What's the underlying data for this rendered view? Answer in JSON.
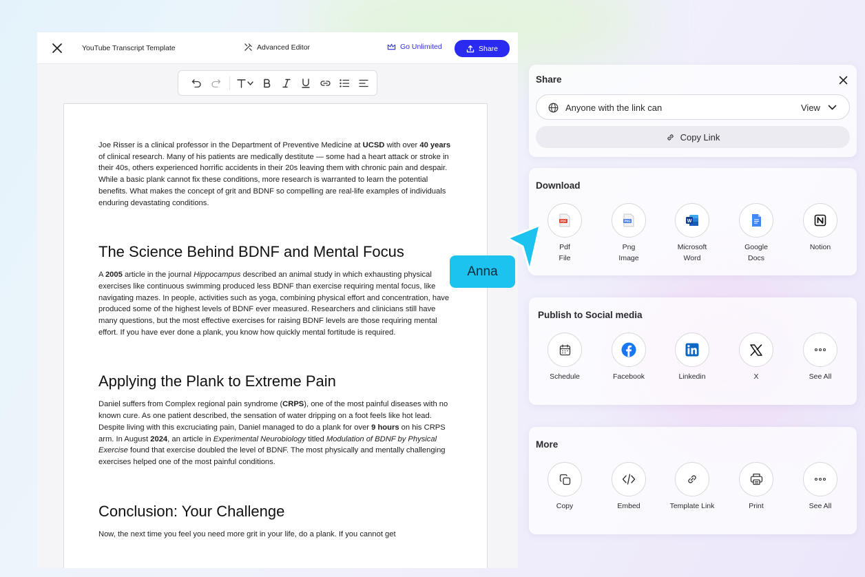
{
  "editor": {
    "doc_title": "YouTube Transcript Template",
    "advanced_editor": "Advanced Editor",
    "go_unlimited": "Go Unlimited",
    "share_button": "Share"
  },
  "document": {
    "intro": {
      "t1": "Joe Risser is a clinical professor in the Department of Preventive Medicine at ",
      "b1": "UCSD",
      "t2": " with over ",
      "b2": "40 years",
      "t3": " of clinical research. Many of his patients are medically destitute — some had a heart attack or stroke in their 40s, others experienced horrific accidents in their 20s leaving them with chronic pain and despair. While a basic plank cannot fix these conditions, more research is warranted to learn the potential benefits. What makes the concept of grit and BDNF so compelling are real-life examples of individuals enduring devastating conditions."
    },
    "h1": "The Science Behind BDNF and Mental Focus",
    "p2": {
      "t1": "A ",
      "b1": "2005",
      "t2": " article in the journal ",
      "i1": "Hippocampus",
      "t3": " described an animal study in which exhausting physical exercises like continuous swimming produced less BDNF than exercise requiring mental focus, like navigating mazes. In people, activities such as yoga, combining physical effort and concentration, have produced some of the highest levels of BDNF ever measured. Researchers and clinicians still have many questions, but the most effective exercises for raising BDNF levels are those requiring mental effort. If you have ever done a plank, you know how quickly mental fortitude is required."
    },
    "h2": "Applying the Plank to Extreme Pain",
    "p3": {
      "t1": "Daniel suffers from Complex regional pain syndrome (",
      "b1": "CRPS",
      "t2": "), one of the most painful diseases with no known cure. As one patient described, the sensation of water dripping on a foot feels like hot lead. Despite living with this excruciating pain, Daniel managed to do a plank for over ",
      "b2": "9 hours",
      "t3": " on his CRPS arm. In August ",
      "b3": "2024",
      "t4": ", an article in ",
      "i1": "Experimental Neurobiology",
      "t5": " titled ",
      "i2": "Modulation of BDNF by Physical Exercise",
      "t6": " found that exercise doubled the level of BDNF. The most physically and mentally challenging exercises helped one of the most painful conditions."
    },
    "h3": "Conclusion: Your Challenge",
    "p4": "Now, the next time you feel you need more grit in your life, do a plank. If you cannot get"
  },
  "share_panel": {
    "title": "Share",
    "access_text": "Anyone with the link can",
    "permission": "View",
    "copy_link": "Copy Link"
  },
  "download_panel": {
    "title": "Download",
    "items": [
      {
        "label": "Pdf\nFile",
        "icon": "pdf-file-icon"
      },
      {
        "label": "Png\nImage",
        "icon": "png-image-icon"
      },
      {
        "label": "Microsoft\nWord",
        "icon": "microsoft-word-icon"
      },
      {
        "label": "Google\nDocs",
        "icon": "google-docs-icon"
      },
      {
        "label": "Notion",
        "icon": "notion-icon"
      }
    ]
  },
  "social_panel": {
    "title": "Publish to Social media",
    "items": [
      {
        "label": "Schedule",
        "icon": "calendar-icon"
      },
      {
        "label": "Facebook",
        "icon": "facebook-icon"
      },
      {
        "label": "Linkedin",
        "icon": "linkedin-icon"
      },
      {
        "label": "X",
        "icon": "x-icon"
      },
      {
        "label": "See All",
        "icon": "more-icon"
      }
    ]
  },
  "more_panel": {
    "title": "More",
    "items": [
      {
        "label": "Copy",
        "icon": "copy-icon"
      },
      {
        "label": "Embed",
        "icon": "embed-code-icon"
      },
      {
        "label": "Template Link",
        "icon": "link-icon"
      },
      {
        "label": "Print",
        "icon": "printer-icon"
      },
      {
        "label": "See All",
        "icon": "more-icon"
      }
    ]
  },
  "collaborator": {
    "name": "Anna"
  },
  "colors": {
    "primary": "#2a2af0",
    "cursor": "#1dc3ef",
    "facebook": "#1877f2",
    "linkedin": "#0a66c2",
    "word": "#185abd",
    "pdf": "#e5442f"
  }
}
